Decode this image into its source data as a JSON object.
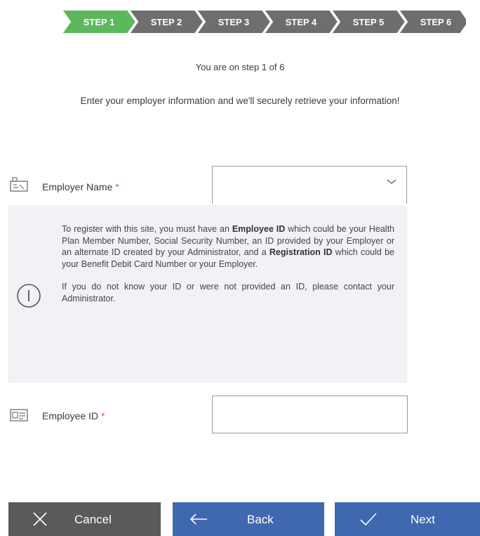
{
  "stepper": {
    "steps": [
      "STEP 1",
      "STEP 2",
      "STEP 3",
      "STEP 4",
      "STEP 5",
      "STEP 6"
    ],
    "active_index": 0,
    "active_color": "#5cb85c",
    "inactive_color": "#6e6e6e"
  },
  "status": {
    "text": "You are on step 1 of 6"
  },
  "instructions": {
    "text": "Enter your employer information and we'll securely retrieve your information!"
  },
  "employer": {
    "label": "Employer Name",
    "required_mark": "*",
    "selected_value": ""
  },
  "info": {
    "p1_pre": "To register with this site, you must have an ",
    "p1_bold1": "Employee ID",
    "p1_mid": " which could be your Health Plan Member Number, Social Security Number, an ID provided by your Employer or an alternate ID created by your Administrator, and a ",
    "p1_bold2": "Registration ID",
    "p1_post": " which could be your Benefit Debit Card Number or your Employer.",
    "p2": "If you do not know your ID or were not provided an ID, please contact your Administrator."
  },
  "employee_id": {
    "label": "Employee ID",
    "required_mark": "*",
    "value": "",
    "placeholder": ""
  },
  "buttons": {
    "cancel": "Cancel",
    "back": "Back",
    "next": "Next"
  },
  "colors": {
    "required": "#d9534f",
    "primary_button": "#3f68b0",
    "cancel_button": "#5a5a5a",
    "info_background": "#f0f2f5"
  }
}
